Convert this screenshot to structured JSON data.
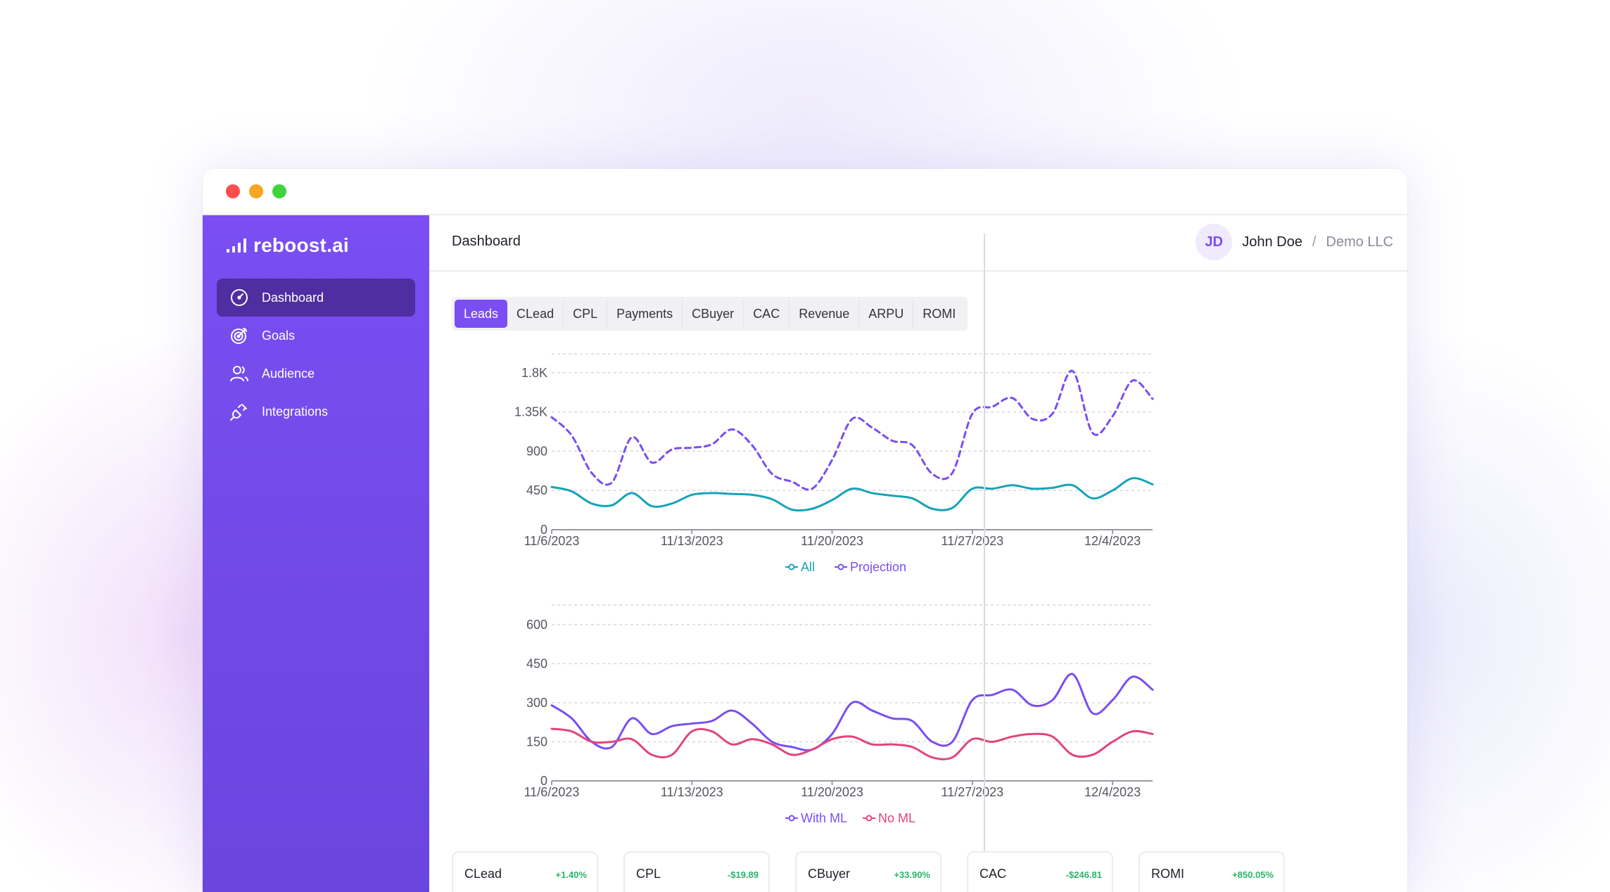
{
  "app": {
    "logo_text": "reboost.ai"
  },
  "sidebar": {
    "items": [
      {
        "label": "Dashboard",
        "icon": "gauge-icon",
        "active": true
      },
      {
        "label": "Goals",
        "icon": "target-icon",
        "active": false
      },
      {
        "label": "Audience",
        "icon": "users-icon",
        "active": false
      },
      {
        "label": "Integrations",
        "icon": "plug-icon",
        "active": false
      }
    ]
  },
  "header": {
    "title": "Dashboard",
    "user": {
      "initials": "JD",
      "name": "John Doe",
      "separator": "/",
      "org": "Demo LLC"
    }
  },
  "tabs": [
    "Leads",
    "CLead",
    "CPL",
    "Payments",
    "CBuyer",
    "CAC",
    "Revenue",
    "ARPU",
    "ROMI"
  ],
  "active_tab": "Leads",
  "colors": {
    "accent": "#7a4ef2",
    "all": "#17a2b8",
    "projection": "#7a4ef2",
    "with_ml": "#7a4ef2",
    "no_ml": "#e0457b",
    "positive": "#2bb36b"
  },
  "chart_data": [
    {
      "type": "line",
      "x": [
        "11/6/2023",
        "11/7/2023",
        "11/8/2023",
        "11/9/2023",
        "11/10/2023",
        "11/11/2023",
        "11/12/2023",
        "11/13/2023",
        "11/14/2023",
        "11/15/2023",
        "11/16/2023",
        "11/17/2023",
        "11/18/2023",
        "11/19/2023",
        "11/20/2023",
        "11/21/2023",
        "11/22/2023",
        "11/23/2023",
        "11/24/2023",
        "11/25/2023",
        "11/26/2023",
        "11/27/2023",
        "11/28/2023",
        "11/29/2023",
        "11/30/2023",
        "12/1/2023",
        "12/2/2023",
        "12/3/2023",
        "12/4/2023",
        "12/5/2023"
      ],
      "x_ticks": [
        "11/6/2023",
        "11/13/2023",
        "11/20/2023",
        "11/27/2023",
        "12/4/2023"
      ],
      "y_ticks": [
        "0",
        "450",
        "900",
        "1.35K",
        "1.8K"
      ],
      "ylim": [
        0,
        2000
      ],
      "grid": true,
      "legend_position": "bottom-center",
      "series": [
        {
          "name": "All",
          "style": "solid",
          "values": [
            490,
            440,
            300,
            280,
            420,
            270,
            300,
            400,
            420,
            410,
            400,
            350,
            230,
            240,
            340,
            470,
            420,
            390,
            360,
            240,
            250,
            470,
            470,
            510,
            470,
            480,
            510,
            360,
            450,
            590,
            520
          ]
        },
        {
          "name": "Projection",
          "style": "dashed",
          "values": [
            1290,
            1080,
            650,
            540,
            1060,
            770,
            920,
            940,
            980,
            1150,
            970,
            640,
            550,
            470,
            800,
            1270,
            1170,
            1020,
            970,
            640,
            650,
            1330,
            1410,
            1510,
            1270,
            1330,
            1820,
            1110,
            1300,
            1710,
            1500
          ]
        }
      ]
    },
    {
      "type": "line",
      "x": [
        "11/6/2023",
        "11/7/2023",
        "11/8/2023",
        "11/9/2023",
        "11/10/2023",
        "11/11/2023",
        "11/12/2023",
        "11/13/2023",
        "11/14/2023",
        "11/15/2023",
        "11/16/2023",
        "11/17/2023",
        "11/18/2023",
        "11/19/2023",
        "11/20/2023",
        "11/21/2023",
        "11/22/2023",
        "11/23/2023",
        "11/24/2023",
        "11/25/2023",
        "11/26/2023",
        "11/27/2023",
        "11/28/2023",
        "11/29/2023",
        "11/30/2023",
        "12/1/2023",
        "12/2/2023",
        "12/3/2023",
        "12/4/2023",
        "12/5/2023"
      ],
      "x_ticks": [
        "11/6/2023",
        "11/13/2023",
        "11/20/2023",
        "11/27/2023",
        "12/4/2023"
      ],
      "y_ticks": [
        "0",
        "150",
        "300",
        "450",
        "600"
      ],
      "ylim": [
        0,
        670
      ],
      "grid": true,
      "legend_position": "bottom-center",
      "series": [
        {
          "name": "With ML",
          "style": "solid",
          "values": [
            290,
            240,
            150,
            130,
            240,
            180,
            210,
            220,
            230,
            270,
            220,
            150,
            130,
            120,
            180,
            300,
            270,
            240,
            230,
            150,
            150,
            310,
            330,
            350,
            290,
            310,
            410,
            260,
            310,
            400,
            350
          ]
        },
        {
          "name": "No ML",
          "style": "solid",
          "values": [
            200,
            190,
            150,
            150,
            160,
            100,
            100,
            190,
            190,
            140,
            160,
            140,
            100,
            120,
            160,
            170,
            140,
            140,
            130,
            90,
            90,
            160,
            150,
            170,
            180,
            170,
            100,
            100,
            150,
            190,
            180
          ]
        }
      ]
    }
  ],
  "kpis": [
    {
      "label": "CLead",
      "delta": "+1.40%"
    },
    {
      "label": "CPL",
      "delta": "-$19.89"
    },
    {
      "label": "CBuyer",
      "delta": "+33.90%"
    },
    {
      "label": "CAC",
      "delta": "-$246.81"
    },
    {
      "label": "ROMI",
      "delta": "+850.05%"
    }
  ]
}
